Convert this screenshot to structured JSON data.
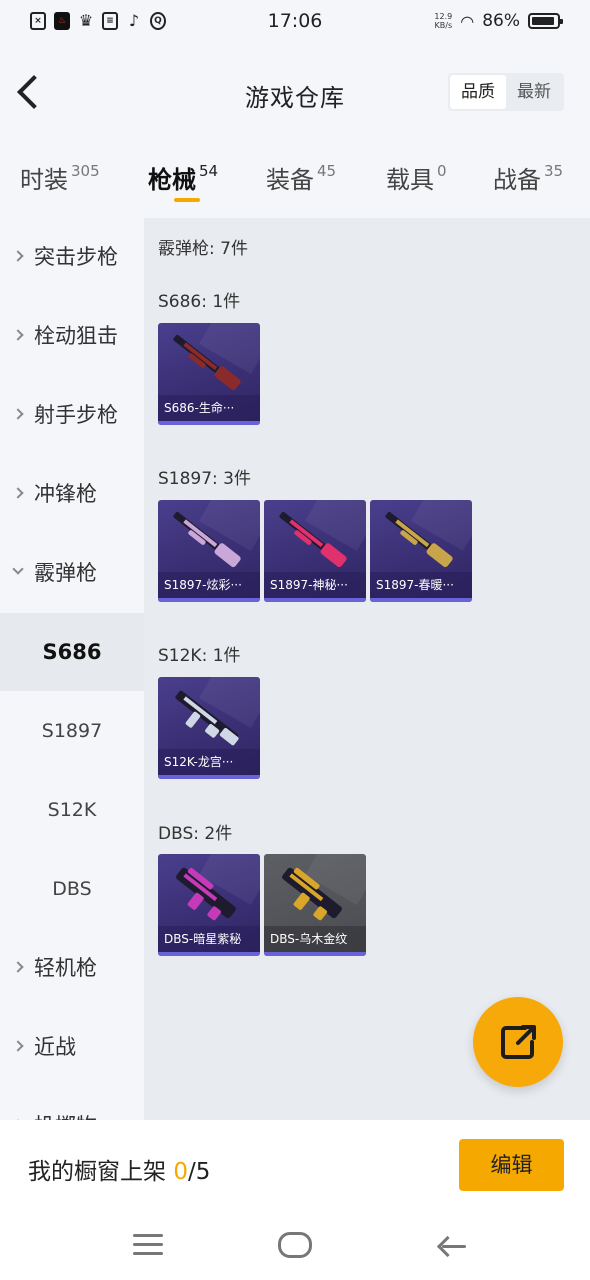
{
  "status_bar": {
    "time": "17:06",
    "net_speed_value": "12.9",
    "net_speed_unit": "KB/s",
    "battery": "86%",
    "icons": [
      "close-box-icon",
      "red-app-icon",
      "crown-icon",
      "wallet-icon",
      "tiktok-icon",
      "q-icon"
    ]
  },
  "header": {
    "title": "游戏仓库",
    "sort_options": [
      "品质",
      "最新"
    ],
    "sort_selected": "品质"
  },
  "tabs": [
    {
      "label": "时装",
      "count": "305"
    },
    {
      "label": "枪械",
      "count": "54",
      "active": true
    },
    {
      "label": "装备",
      "count": "45"
    },
    {
      "label": "载具",
      "count": "0"
    },
    {
      "label": "战备",
      "count": "35"
    }
  ],
  "sidebar": {
    "categories": [
      "突击步枪",
      "栓动狙击",
      "射手步枪",
      "冲锋枪",
      "霰弹枪"
    ],
    "sub_items": [
      "S686",
      "S1897",
      "S12K",
      "DBS"
    ],
    "active_sub": "S686",
    "more_categories": [
      "轻机枪",
      "近战",
      "投掷物"
    ]
  },
  "content": {
    "summary": "霰弹枪: 7件",
    "groups": [
      {
        "heading": "S686: 1件",
        "items": [
          {
            "name": "S686-生命···",
            "color": "#8a2a2a"
          }
        ]
      },
      {
        "heading": "S1897: 3件",
        "items": [
          {
            "name": "S1897-炫彩···",
            "color": "#c9a7d8"
          },
          {
            "name": "S1897-神秘···",
            "color": "#e0306e"
          },
          {
            "name": "S1897-春暖···",
            "color": "#c8a44a"
          }
        ]
      },
      {
        "heading": "S12K: 1件",
        "items": [
          {
            "name": "S12K-龙宫···",
            "color": "#cfd8e4"
          }
        ]
      },
      {
        "heading": "DBS: 2件",
        "items": [
          {
            "name": "DBS-暗星紫秘",
            "color": "#c43ab8"
          },
          {
            "name": "DBS-乌木金纹",
            "color": "#d9a62a",
            "gray": true
          }
        ]
      }
    ]
  },
  "bottom": {
    "label": "我的橱窗上架",
    "current": "0",
    "total": "/5",
    "edit_label": "编辑"
  },
  "colors": {
    "accent": "#f5a800",
    "card_purple": "#3a2f74",
    "card_gray": "#4a4b50"
  }
}
